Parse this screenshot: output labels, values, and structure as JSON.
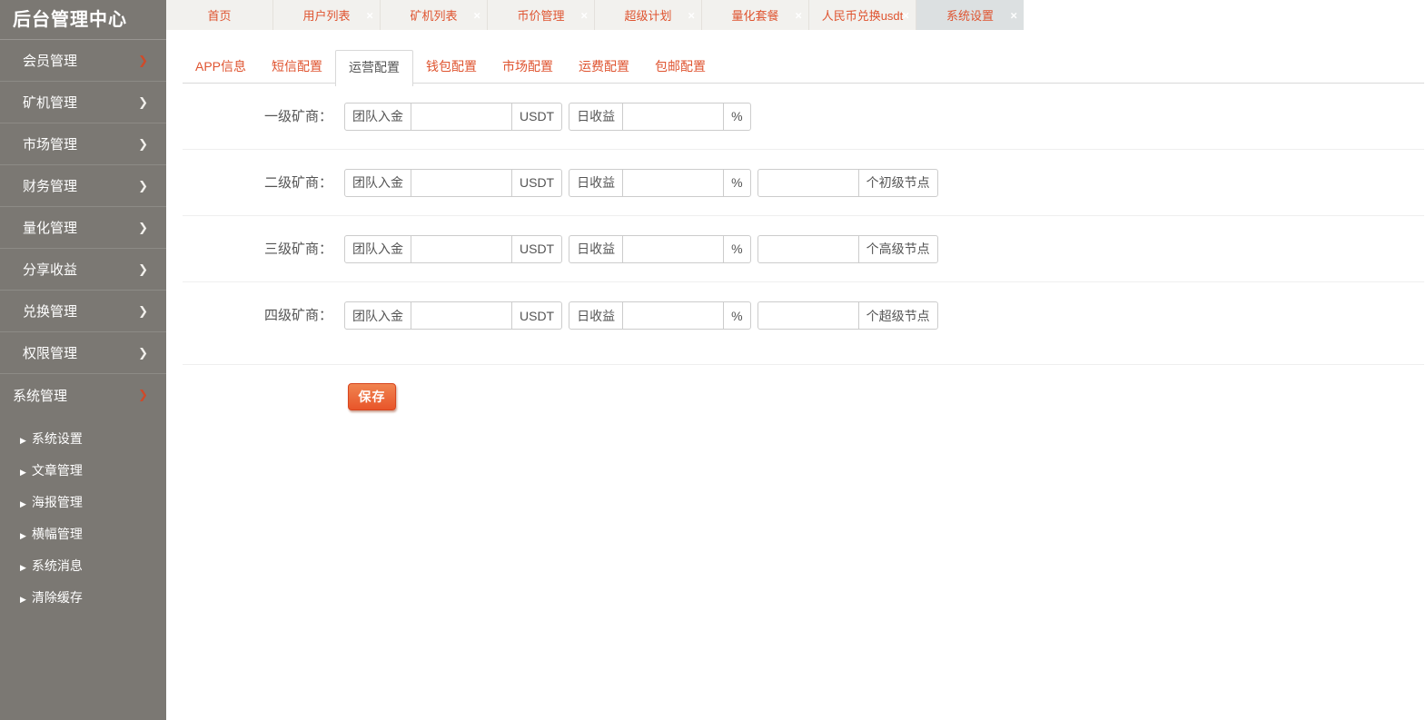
{
  "icons": {
    "chevron_right": "❯",
    "caret_right": "▶",
    "close": "×"
  },
  "colors": {
    "accent": "#df5430",
    "sidebar_bg": "#7b7873",
    "topbar_bg": "#f2f1ee",
    "active_top_tab_bg": "#dce0e1",
    "button_bg": "#e8552a",
    "input_border": "#cccccc"
  },
  "sidebar": {
    "title": "后台管理中心",
    "items": [
      {
        "label": "会员管理",
        "accent_arrow": true,
        "expanded": false
      },
      {
        "label": "矿机管理",
        "accent_arrow": false,
        "expanded": false
      },
      {
        "label": "市场管理",
        "accent_arrow": false,
        "expanded": false
      },
      {
        "label": "财务管理",
        "accent_arrow": false,
        "expanded": false
      },
      {
        "label": "量化管理",
        "accent_arrow": false,
        "expanded": false
      },
      {
        "label": "分享收益",
        "accent_arrow": false,
        "expanded": false
      },
      {
        "label": "兑换管理",
        "accent_arrow": false,
        "expanded": false
      },
      {
        "label": "权限管理",
        "accent_arrow": false,
        "expanded": false
      },
      {
        "label": "系统管理",
        "accent_arrow": true,
        "expanded": true
      }
    ],
    "subitems": [
      {
        "label": "系统设置"
      },
      {
        "label": "文章管理"
      },
      {
        "label": "海报管理"
      },
      {
        "label": "横幅管理"
      },
      {
        "label": "系统消息"
      },
      {
        "label": "清除缓存"
      }
    ]
  },
  "topbar": {
    "tabs": [
      {
        "label": "首页",
        "closable": false,
        "active": false
      },
      {
        "label": "用户列表",
        "closable": true,
        "active": false
      },
      {
        "label": "矿机列表",
        "closable": true,
        "active": false
      },
      {
        "label": "币价管理",
        "closable": true,
        "active": false
      },
      {
        "label": "超级计划",
        "closable": true,
        "active": false
      },
      {
        "label": "量化套餐",
        "closable": true,
        "active": false
      },
      {
        "label": "人民币兑换usdt",
        "closable": true,
        "active": false
      },
      {
        "label": "系统设置",
        "closable": true,
        "active": true
      }
    ]
  },
  "subtabs": {
    "tabs": [
      {
        "label": "APP信息",
        "active": false
      },
      {
        "label": "短信配置",
        "active": false
      },
      {
        "label": "运营配置",
        "active": true
      },
      {
        "label": "钱包配置",
        "active": false
      },
      {
        "label": "市场配置",
        "active": false
      },
      {
        "label": "运费配置",
        "active": false
      },
      {
        "label": "包邮配置",
        "active": false
      }
    ]
  },
  "form": {
    "rows": [
      {
        "label": "一级矿商：",
        "groups": [
          {
            "prefix": "团队入金",
            "value": "",
            "suffix": "USDT"
          },
          {
            "prefix": "日收益",
            "value": "",
            "suffix": "%"
          }
        ]
      },
      {
        "label": "二级矿商：",
        "groups": [
          {
            "prefix": "团队入金",
            "value": "",
            "suffix": "USDT"
          },
          {
            "prefix": "日收益",
            "value": "",
            "suffix": "%"
          },
          {
            "value": "",
            "suffix": "个初级节点"
          }
        ]
      },
      {
        "label": "三级矿商：",
        "groups": [
          {
            "prefix": "团队入金",
            "value": "",
            "suffix": "USDT"
          },
          {
            "prefix": "日收益",
            "value": "",
            "suffix": "%"
          },
          {
            "value": "",
            "suffix": "个高级节点"
          }
        ]
      },
      {
        "label": "四级矿商：",
        "groups": [
          {
            "prefix": "团队入金",
            "value": "",
            "suffix": "USDT"
          },
          {
            "prefix": "日收益",
            "value": "",
            "suffix": "%"
          },
          {
            "value": "",
            "suffix": "个超级节点"
          }
        ]
      }
    ],
    "save_label": "保存"
  }
}
